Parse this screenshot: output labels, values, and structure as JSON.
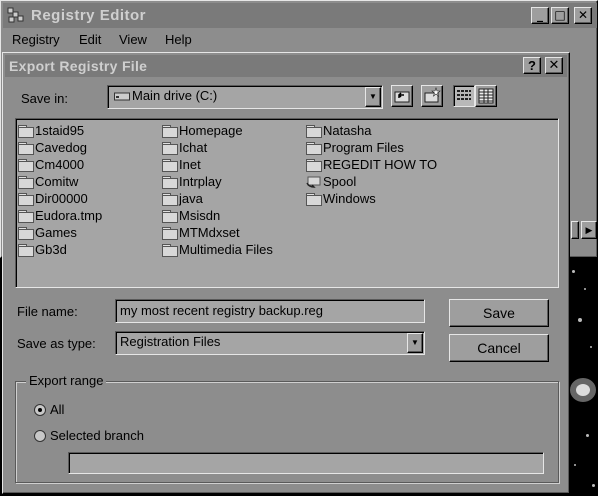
{
  "registry_window": {
    "title": "Registry Editor",
    "caption_buttons": {
      "minimize": "_",
      "maximize": "□",
      "close": "✕"
    },
    "menu": [
      "Registry",
      "Edit",
      "View",
      "Help"
    ]
  },
  "export_dialog": {
    "title": "Export Registry File",
    "help_button": "?",
    "close_button": "✕",
    "save_in": {
      "label": "Save in:",
      "value": "Main drive (C:)"
    },
    "folders": [
      "1staid95",
      "Cavedog",
      "Cm4000",
      "Comitw",
      "Dir00000",
      "Eudora.tmp",
      "Games",
      "Gb3d",
      "Homepage",
      "Ichat",
      "Inet",
      "Intrplay",
      "java",
      "Msisdn",
      "MTMdxset",
      "Multimedia Files",
      "Natasha",
      "Program Files",
      "REGEDIT HOW TO",
      "Spool",
      "Windows"
    ],
    "file_name": {
      "label": "File name:",
      "value": "my most recent registry backup.reg"
    },
    "save_as_type": {
      "label": "Save as type:",
      "value": "Registration Files"
    },
    "buttons": {
      "save": "Save",
      "cancel": "Cancel"
    },
    "export_range": {
      "legend": "Export range",
      "options": [
        "All",
        "Selected branch"
      ],
      "selected": "All",
      "branch_value": ""
    }
  }
}
